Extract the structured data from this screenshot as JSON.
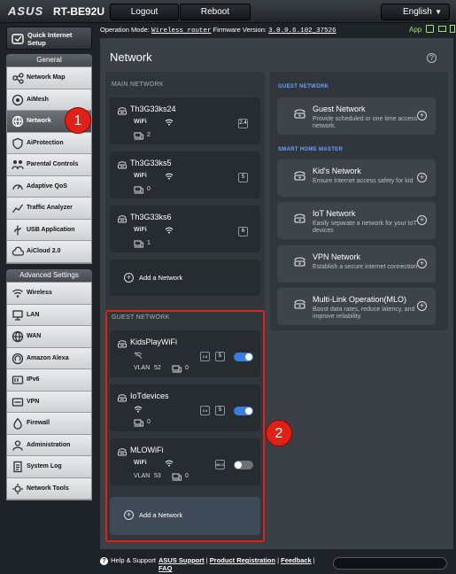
{
  "header": {
    "logo": "ASUS",
    "model": "RT-BE92U",
    "logout_label": "Logout",
    "reboot_label": "Reboot",
    "language": "English"
  },
  "status": {
    "prefix": "Operation Mode:",
    "mode": "Wireless router",
    "fw_prefix": "Firmware Version:",
    "firmware": "3.0.0.6.102_37526",
    "app_label": "App"
  },
  "sidebar": {
    "quick_setup": "Quick Internet Setup",
    "general_title": "General",
    "general_items": [
      {
        "label": "Network Map",
        "icon": "network-map-icon"
      },
      {
        "label": "AiMesh",
        "icon": "aimesh-icon"
      },
      {
        "label": "Network",
        "icon": "network-globe-icon"
      },
      {
        "label": "AiProtection",
        "icon": "shield-icon"
      },
      {
        "label": "Parental Controls",
        "icon": "family-icon"
      },
      {
        "label": "Adaptive QoS",
        "icon": "gauge-icon"
      },
      {
        "label": "Traffic Analyzer",
        "icon": "chart-icon"
      },
      {
        "label": "USB Application",
        "icon": "usb-icon"
      },
      {
        "label": "AiCloud 2.0",
        "icon": "cloud-icon"
      }
    ],
    "advanced_title": "Advanced Settings",
    "advanced_items": [
      {
        "label": "Wireless",
        "icon": "wifi-icon"
      },
      {
        "label": "LAN",
        "icon": "lan-icon"
      },
      {
        "label": "WAN",
        "icon": "globe-icon"
      },
      {
        "label": "Amazon Alexa",
        "icon": "alexa-icon"
      },
      {
        "label": "IPv6",
        "icon": "ipv6-icon"
      },
      {
        "label": "VPN",
        "icon": "vpn-icon"
      },
      {
        "label": "Firewall",
        "icon": "firewall-icon"
      },
      {
        "label": "Administration",
        "icon": "admin-icon"
      },
      {
        "label": "System Log",
        "icon": "log-icon"
      },
      {
        "label": "Network Tools",
        "icon": "tools-icon"
      }
    ]
  },
  "page": {
    "title": "Network",
    "help_icon": "?",
    "main_section": "MAIN NETWORK",
    "main_networks": [
      {
        "name": "Th3G33ks24",
        "band": "2.4",
        "clients": "2"
      },
      {
        "name": "Th3G33ks5",
        "band": "5",
        "clients": "0"
      },
      {
        "name": "Th3G33ks6",
        "band": "6",
        "clients": "1"
      }
    ],
    "add_network": "Add a Network",
    "guest_section": "GUEST NETWORK",
    "guest_networks": [
      {
        "name": "KidsPlayWiFi",
        "bands": [
          "2.4",
          "5"
        ],
        "vlan": "52",
        "clients": "0",
        "enabled": true
      },
      {
        "name": "IoTdevices",
        "bands": [
          "2.4",
          "5"
        ],
        "clients": "0",
        "enabled": true
      },
      {
        "name": "MLOWiFi",
        "bands": [
          "MLO"
        ],
        "vlan": "53",
        "clients": "0",
        "enabled": false
      }
    ],
    "add_network2": "Add a Network",
    "wifi_label": "WiFi",
    "vlan_label": "VLAN",
    "right_guest_section": "GUEST NETWORK",
    "smart_home_section": "SMART HOME MASTER",
    "types": [
      {
        "title": "Guest Network",
        "desc": "Provide scheduled or one time access network."
      },
      {
        "title": "Kid's Network",
        "desc": "Ensure Internet access safety for kid"
      },
      {
        "title": "IoT Network",
        "desc": "Easily separate a network for your IoT devices"
      },
      {
        "title": "VPN Network",
        "desc": "Establish a secure internet connection"
      },
      {
        "title": "Multi-Link Operation(MLO)",
        "desc": "Boost data rates, reduce latency, and improve reliability."
      }
    ]
  },
  "callouts": {
    "one": "1",
    "two": "2"
  },
  "footer": {
    "help": "Help & Support",
    "asus_support": "ASUS Support",
    "sep1": " | ",
    "product_reg": "Product Registration",
    "sep2": " | ",
    "feedback": "Feedback",
    "sep3": " |",
    "faq": "FAQ"
  },
  "colors": {
    "accent": "#3b7ddd",
    "callout": "#e0211a",
    "panel": "#3a4045"
  }
}
